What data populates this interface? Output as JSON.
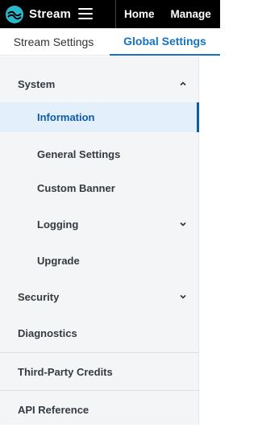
{
  "header": {
    "brand": "Stream",
    "nav": [
      "Home",
      "Manage"
    ]
  },
  "tabs": [
    {
      "label": "Stream Settings",
      "active": false
    },
    {
      "label": "Global Settings",
      "active": true
    }
  ],
  "sidebar": {
    "items": [
      {
        "label": "System",
        "expanded": true
      },
      {
        "label": "Information",
        "active": true
      },
      {
        "label": "General Settings"
      },
      {
        "label": "Custom Banner"
      },
      {
        "label": "Logging",
        "expanded": false
      },
      {
        "label": "Upgrade"
      },
      {
        "label": "Security",
        "expanded": false
      },
      {
        "label": "Diagnostics"
      },
      {
        "label": "Third-Party Credits"
      },
      {
        "label": "API Reference"
      }
    ]
  },
  "colors": {
    "topbar": "#000000",
    "accent": "#1473c4",
    "active_text": "#0d5aa7",
    "active_bg": "#e3f0fb",
    "sidebar_bg": "#f4f5f7",
    "logo": "#2bb8c8"
  },
  "icons": {
    "logo": "stream-logo-icon",
    "menu": "hamburger-menu-icon",
    "expand": "chevron-icon"
  }
}
